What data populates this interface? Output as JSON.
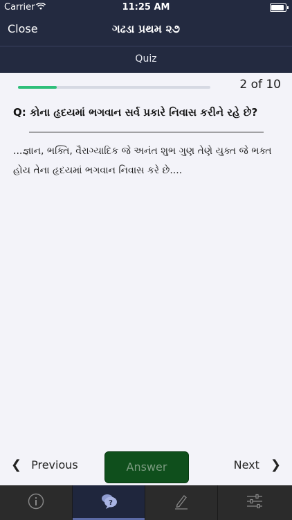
{
  "status": {
    "carrier": "Carrier",
    "time": "11:25 AM"
  },
  "nav": {
    "close_label": "Close",
    "title": "ગઢડા પ્રથમ ૨૭"
  },
  "subnav": {
    "label": "Quiz"
  },
  "progress": {
    "current": 2,
    "total": 10,
    "label": "2 of 10",
    "fraction": 0.2
  },
  "question": {
    "text": "Q: કોના હૃદયમાં ભગવાન સર્વ પ્રકારે નિવાસ કરીને રહે છે?"
  },
  "answer": {
    "text": "...જ્ઞાન, ભક્તિ, વૈરાગ્યાદિક જે અનંત શુભ ગુણ તેણે યુક્ત જે ભક્ત હોય તેના હૃદયમાં ભગવાન નિવાસ કરે છે...."
  },
  "footer": {
    "previous_label": "Previous",
    "answer_label": "Answer",
    "next_label": "Next"
  },
  "tabs": [
    {
      "icon": "info-icon",
      "active": false
    },
    {
      "icon": "quiz-icon",
      "active": true
    },
    {
      "icon": "edit-icon",
      "active": false
    },
    {
      "icon": "settings-sliders-icon",
      "active": false
    }
  ],
  "colors": {
    "header": "#232a40",
    "progress": "#2fbf7a",
    "answer_button": "#0f4f1c",
    "tab_bar": "#2b2b2b"
  }
}
